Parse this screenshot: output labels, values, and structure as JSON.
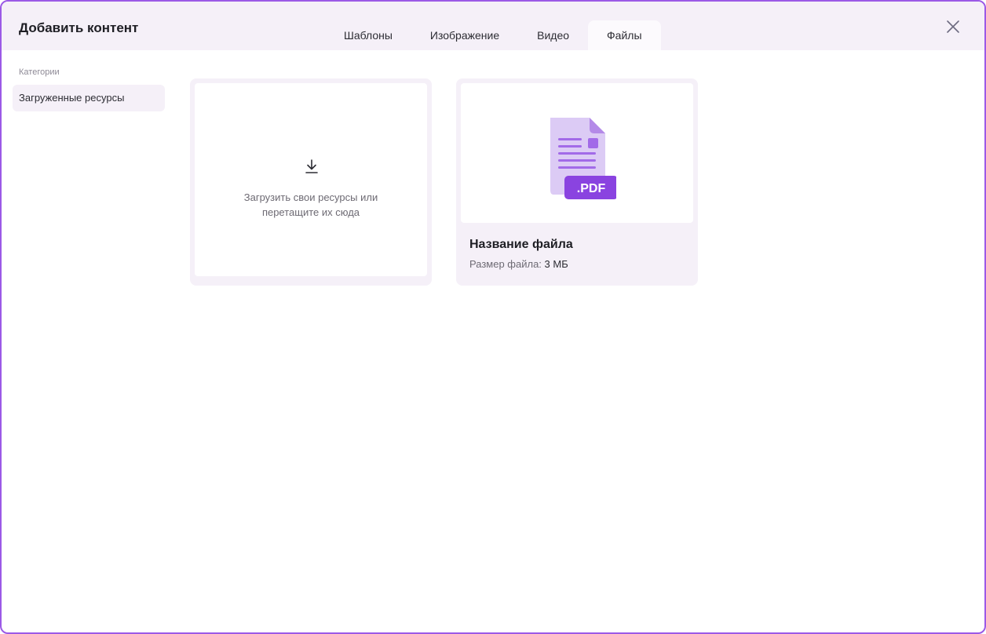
{
  "dialog": {
    "title": "Добавить контент",
    "close_icon": "close-icon"
  },
  "tabs": [
    {
      "label": "Шаблоны",
      "active": false
    },
    {
      "label": "Изображение",
      "active": false
    },
    {
      "label": "Видео",
      "active": false
    },
    {
      "label": "Файлы",
      "active": true
    }
  ],
  "sidebar": {
    "heading": "Категории",
    "items": [
      {
        "label": "Загруженные ресурсы",
        "selected": true
      }
    ]
  },
  "upload": {
    "icon": "download-icon",
    "text_line1": "Загрузить свои ресурсы или",
    "text_line2": "перетащите их сюда"
  },
  "files": [
    {
      "icon": "pdf-file-icon",
      "badge": ".PDF",
      "name": "Название файла",
      "size_label": "Размер файла:",
      "size_value": "3 МБ"
    }
  ],
  "colors": {
    "border_accent": "#9b59e6",
    "header_bg": "#f5f0f8",
    "pdf_badge": "#8a43e0",
    "pdf_doc": "#dccbf5",
    "pdf_lines": "#a26ae8"
  }
}
